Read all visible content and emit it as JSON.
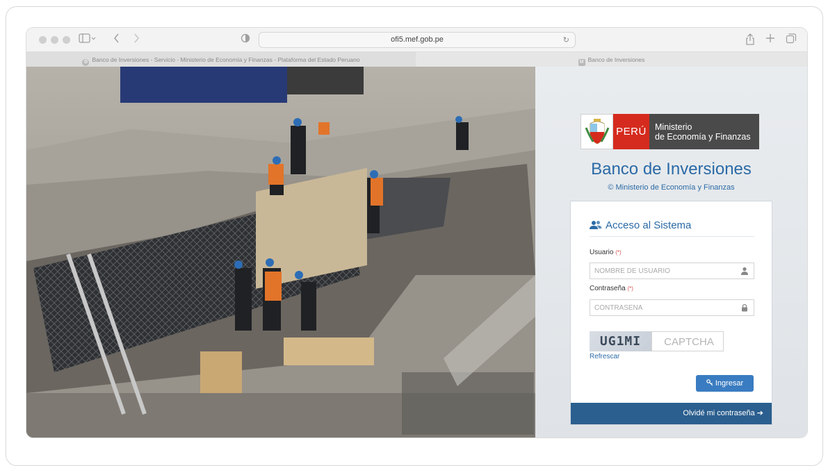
{
  "browser": {
    "url": "ofi5.mef.gob.pe",
    "tabs": [
      {
        "label": "Banco de Inversiones - Servicio - Ministerio de Economía y Finanzas - Plataforma del Estado Peruano",
        "favicon": "gob-pe-icon"
      },
      {
        "label": "Banco de Inversiones",
        "favicon": "M"
      }
    ]
  },
  "logo": {
    "peru": "PERÚ",
    "ministry_line1": "Ministerio",
    "ministry_line2": "de Economía y Finanzas"
  },
  "page": {
    "title": "Banco de Inversiones",
    "subtitle": "© Ministerio de Economía y Finanzas"
  },
  "login": {
    "heading": "Acceso al Sistema",
    "user_label": "Usuario",
    "user_placeholder": "NOMBRE DE USUARIO",
    "password_label": "Contraseña",
    "password_placeholder": "CONTRASEÑA",
    "required_mark": "(*)",
    "captcha_code": "UG1MI",
    "captcha_placeholder": "CAPTCHA",
    "refresh_label": "Refrescar",
    "submit_label": "Ingresar",
    "forgot_label": "Olvidé mi contraseña",
    "forgot_arrow": "➔"
  },
  "colors": {
    "brand_blue": "#2b6aa6",
    "button_blue": "#3a7cc1",
    "footer_blue": "#2b5f8f",
    "peru_red": "#d52b1e"
  }
}
